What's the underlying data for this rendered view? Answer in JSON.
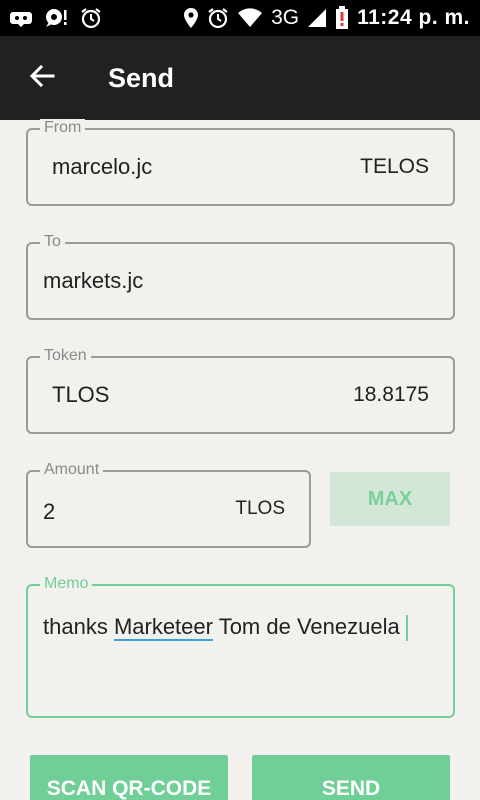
{
  "status_bar": {
    "network": "3G",
    "time": "11:24 p. m."
  },
  "toolbar": {
    "title": "Send"
  },
  "form": {
    "from": {
      "label": "From",
      "value": "marcelo.jc",
      "suffix": "TELOS"
    },
    "to": {
      "label": "To",
      "value": "markets.jc"
    },
    "token": {
      "label": "Token",
      "value": "TLOS",
      "suffix": "18.8175"
    },
    "amount": {
      "label": "Amount",
      "value": "2",
      "suffix": "TLOS",
      "max_label": "MAX"
    },
    "memo": {
      "label": "Memo",
      "text_before": "thanks ",
      "text_spell": "Marketeer",
      "text_after": " Tom de Venezuela"
    }
  },
  "actions": {
    "scan_label": "SCAN QR-CODE",
    "send_label": "SEND"
  },
  "colors": {
    "accent": "#6fcf97",
    "toolbar": "#212121",
    "background": "#f2f1ee"
  }
}
